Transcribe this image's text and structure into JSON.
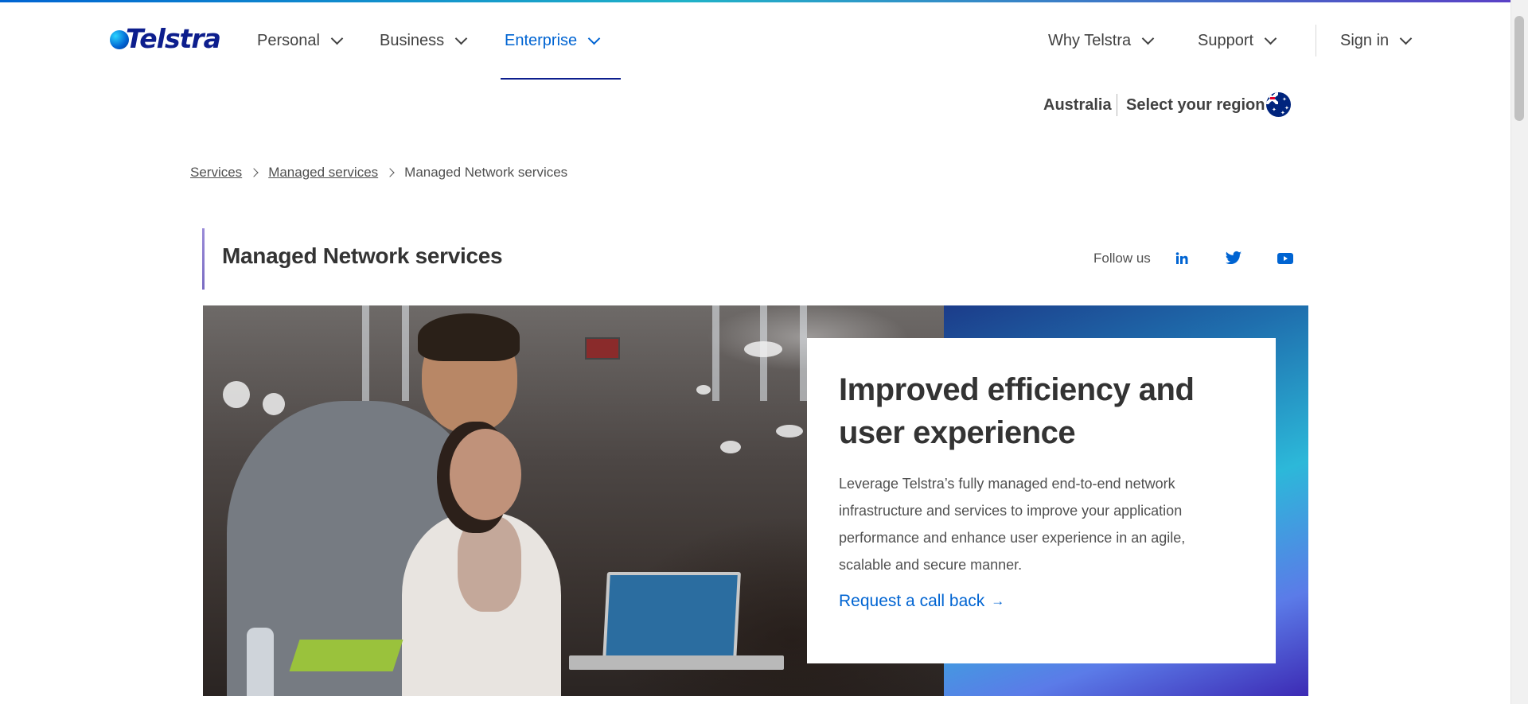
{
  "brand": {
    "logo_text": "Telstra",
    "accent": "#0064d2",
    "navy": "#0d1e8d"
  },
  "nav": {
    "items": [
      {
        "label": "Personal"
      },
      {
        "label": "Business"
      },
      {
        "label": "Enterprise",
        "active": true
      }
    ],
    "right_items": [
      {
        "label": "Why Telstra"
      },
      {
        "label": "Support"
      },
      {
        "label": "Sign in"
      }
    ]
  },
  "region": {
    "country": "Australia",
    "select_label": "Select your region",
    "flag_icon": "australia-flag-icon"
  },
  "breadcrumb": {
    "items": [
      "Services",
      "Managed services"
    ],
    "current": "Managed Network services"
  },
  "page": {
    "title": "Managed Network services"
  },
  "social": {
    "label": "Follow us",
    "icons": [
      "linkedin-icon",
      "twitter-icon",
      "youtube-icon"
    ]
  },
  "hero": {
    "title": "Improved efficiency and user experience",
    "body": "Leverage Telstra’s fully managed end-to-end network infrastructure and services to improve your application performance and enhance user experience in an agile, scalable and secure manner.",
    "link_label": "Request a call back",
    "link_arrow": "→"
  }
}
